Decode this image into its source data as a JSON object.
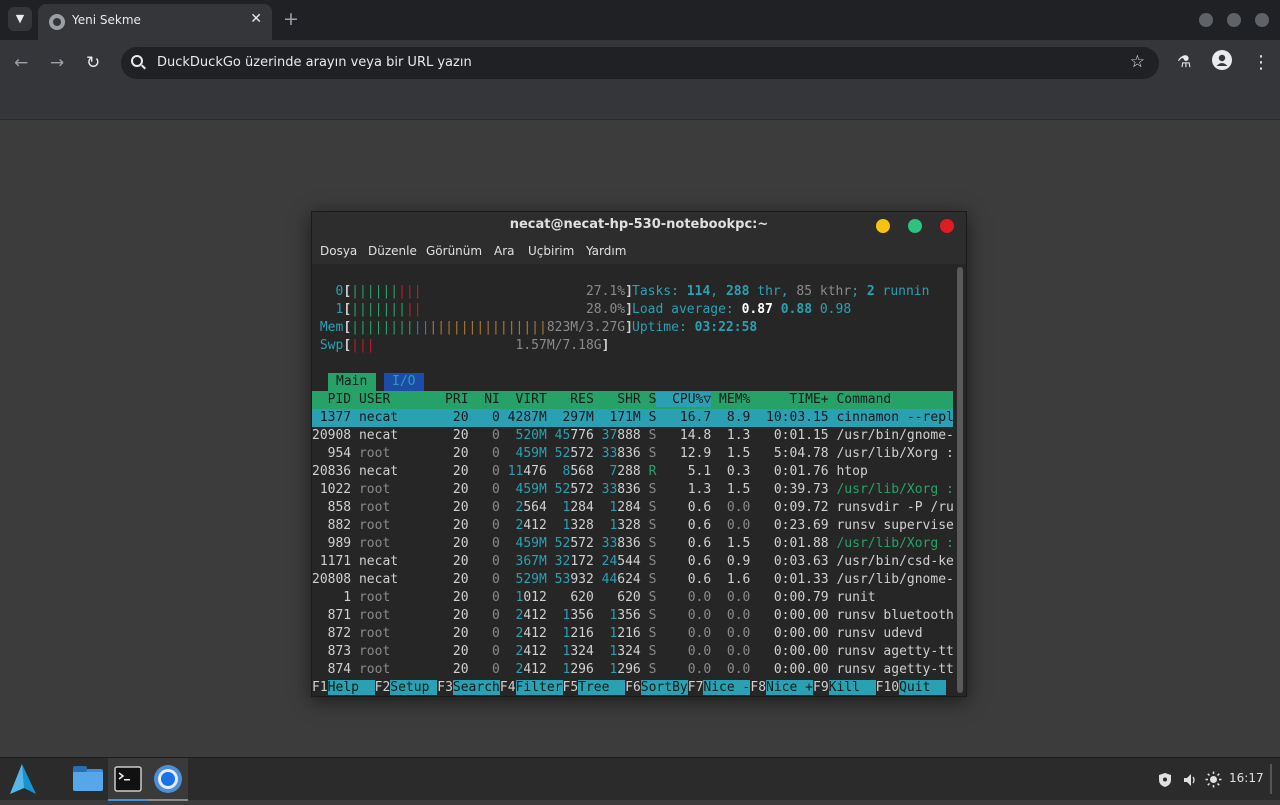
{
  "browser": {
    "tab_title": "Yeni Sekme",
    "tab_close": "✕",
    "new_tab": "+",
    "omnibox_placeholder": "DuckDuckGo üzerinde arayın veya bir URL yazın",
    "back": "←",
    "forward": "→",
    "reload": "↻",
    "star": "☆",
    "labs": "⚗",
    "profile": "●",
    "menu": "⋮"
  },
  "terminal": {
    "title": "necat@necat-hp-530-notebookpc:~",
    "menu": [
      "Dosya",
      "Düzenle",
      "Görünüm",
      "Ara",
      "Uçbirim",
      "Yardım"
    ],
    "meters": {
      "cpu0": {
        "label": "0",
        "value": "27.1%"
      },
      "cpu1": {
        "label": "1",
        "value": "28.0%"
      },
      "mem": {
        "label": "Mem",
        "value": "823M/3.27G"
      },
      "swp": {
        "label": "Swp",
        "value": "1.57M/7.18G"
      }
    },
    "tasks": {
      "label": "Tasks: ",
      "count": "114",
      "thr": "288",
      "kthr": "85",
      "running": "2",
      "tail": " runnin"
    },
    "load": {
      "label": "Load average: ",
      "l1": "0.87",
      "l5": "0.88",
      "l15": "0.98"
    },
    "uptime": {
      "label": "Uptime: ",
      "value": "03:22:58"
    },
    "tabs": [
      "Main",
      "I/O"
    ],
    "header": [
      "PID",
      "USER",
      "PRI",
      "NI",
      "VIRT",
      "RES",
      "SHR",
      "S",
      "CPU%▽",
      "MEM%",
      "TIME+",
      "Command"
    ],
    "processes": [
      {
        "pid": "1377",
        "user": "necat",
        "pri": "20",
        "ni": "0",
        "virt": "4287M",
        "res": "297M",
        "shr": "171M",
        "s": "S",
        "cpu": "16.7",
        "mem": "8.9",
        "time": "10:03.15",
        "cmd": "cinnamon --repl"
      },
      {
        "pid": "20908",
        "user": "necat",
        "pri": "20",
        "ni": "0",
        "virt": "520M",
        "res": "45776",
        "shr": "37888",
        "s": "S",
        "cpu": "14.8",
        "mem": "1.3",
        "time": "0:01.15",
        "cmd": "/usr/bin/gnome-"
      },
      {
        "pid": "954",
        "user": "root",
        "pri": "20",
        "ni": "0",
        "virt": "459M",
        "res": "52572",
        "shr": "33836",
        "s": "S",
        "cpu": "12.9",
        "mem": "1.5",
        "time": "5:04.78",
        "cmd": "/usr/lib/Xorg :"
      },
      {
        "pid": "20836",
        "user": "necat",
        "pri": "20",
        "ni": "0",
        "virt": "11476",
        "res": "8568",
        "shr": "7288",
        "s": "R",
        "cpu": "5.1",
        "mem": "0.3",
        "time": "0:01.76",
        "cmd": "htop"
      },
      {
        "pid": "1022",
        "user": "root",
        "pri": "20",
        "ni": "0",
        "virt": "459M",
        "res": "52572",
        "shr": "33836",
        "s": "S",
        "cpu": "1.3",
        "mem": "1.5",
        "time": "0:39.73",
        "cmd": "/usr/lib/Xorg :"
      },
      {
        "pid": "858",
        "user": "root",
        "pri": "20",
        "ni": "0",
        "virt": "2564",
        "res": "1284",
        "shr": "1284",
        "s": "S",
        "cpu": "0.6",
        "mem": "0.0",
        "time": "0:09.72",
        "cmd": "runsvdir -P /ru"
      },
      {
        "pid": "882",
        "user": "root",
        "pri": "20",
        "ni": "0",
        "virt": "2412",
        "res": "1328",
        "shr": "1328",
        "s": "S",
        "cpu": "0.6",
        "mem": "0.0",
        "time": "0:23.69",
        "cmd": "runsv supervise"
      },
      {
        "pid": "989",
        "user": "root",
        "pri": "20",
        "ni": "0",
        "virt": "459M",
        "res": "52572",
        "shr": "33836",
        "s": "S",
        "cpu": "0.6",
        "mem": "1.5",
        "time": "0:01.88",
        "cmd": "/usr/lib/Xorg :"
      },
      {
        "pid": "1171",
        "user": "necat",
        "pri": "20",
        "ni": "0",
        "virt": "367M",
        "res": "32172",
        "shr": "24544",
        "s": "S",
        "cpu": "0.6",
        "mem": "0.9",
        "time": "0:03.63",
        "cmd": "/usr/bin/csd-ke"
      },
      {
        "pid": "20808",
        "user": "necat",
        "pri": "20",
        "ni": "0",
        "virt": "529M",
        "res": "53932",
        "shr": "44624",
        "s": "S",
        "cpu": "0.6",
        "mem": "1.6",
        "time": "0:01.33",
        "cmd": "/usr/lib/gnome-"
      },
      {
        "pid": "1",
        "user": "root",
        "pri": "20",
        "ni": "0",
        "virt": "1012",
        "res": "620",
        "shr": "620",
        "s": "S",
        "cpu": "0.0",
        "mem": "0.0",
        "time": "0:00.79",
        "cmd": "runit"
      },
      {
        "pid": "871",
        "user": "root",
        "pri": "20",
        "ni": "0",
        "virt": "2412",
        "res": "1356",
        "shr": "1356",
        "s": "S",
        "cpu": "0.0",
        "mem": "0.0",
        "time": "0:00.00",
        "cmd": "runsv bluetooth"
      },
      {
        "pid": "872",
        "user": "root",
        "pri": "20",
        "ni": "0",
        "virt": "2412",
        "res": "1216",
        "shr": "1216",
        "s": "S",
        "cpu": "0.0",
        "mem": "0.0",
        "time": "0:00.00",
        "cmd": "runsv udevd"
      },
      {
        "pid": "873",
        "user": "root",
        "pri": "20",
        "ni": "0",
        "virt": "2412",
        "res": "1324",
        "shr": "1324",
        "s": "S",
        "cpu": "0.0",
        "mem": "0.0",
        "time": "0:00.00",
        "cmd": "runsv agetty-tt"
      },
      {
        "pid": "874",
        "user": "root",
        "pri": "20",
        "ni": "0",
        "virt": "2412",
        "res": "1296",
        "shr": "1296",
        "s": "S",
        "cpu": "0.0",
        "mem": "0.0",
        "time": "0:00.00",
        "cmd": "runsv agetty-tt"
      }
    ],
    "fkeys": [
      {
        "key": "F1",
        "label": "Help  "
      },
      {
        "key": "F2",
        "label": "Setup "
      },
      {
        "key": "F3",
        "label": "Search"
      },
      {
        "key": "F4",
        "label": "Filter"
      },
      {
        "key": "F5",
        "label": "Tree  "
      },
      {
        "key": "F6",
        "label": "SortBy"
      },
      {
        "key": "F7",
        "label": "Nice -"
      },
      {
        "key": "F8",
        "label": "Nice +"
      },
      {
        "key": "F9",
        "label": "Kill  "
      },
      {
        "key": "F10",
        "label": "Quit  "
      }
    ]
  },
  "taskbar": {
    "clock": "16:17"
  },
  "colors": {
    "htop_green": "#26a269",
    "htop_cyan": "#2aa1b3",
    "htop_teal_text": "#2aa1b3",
    "htop_red": "#c01c28",
    "htop_blue": "#1c4ca8",
    "dot_yellow": "#f5c211",
    "dot_green": "#2ec27e",
    "dot_red": "#e01b24"
  }
}
